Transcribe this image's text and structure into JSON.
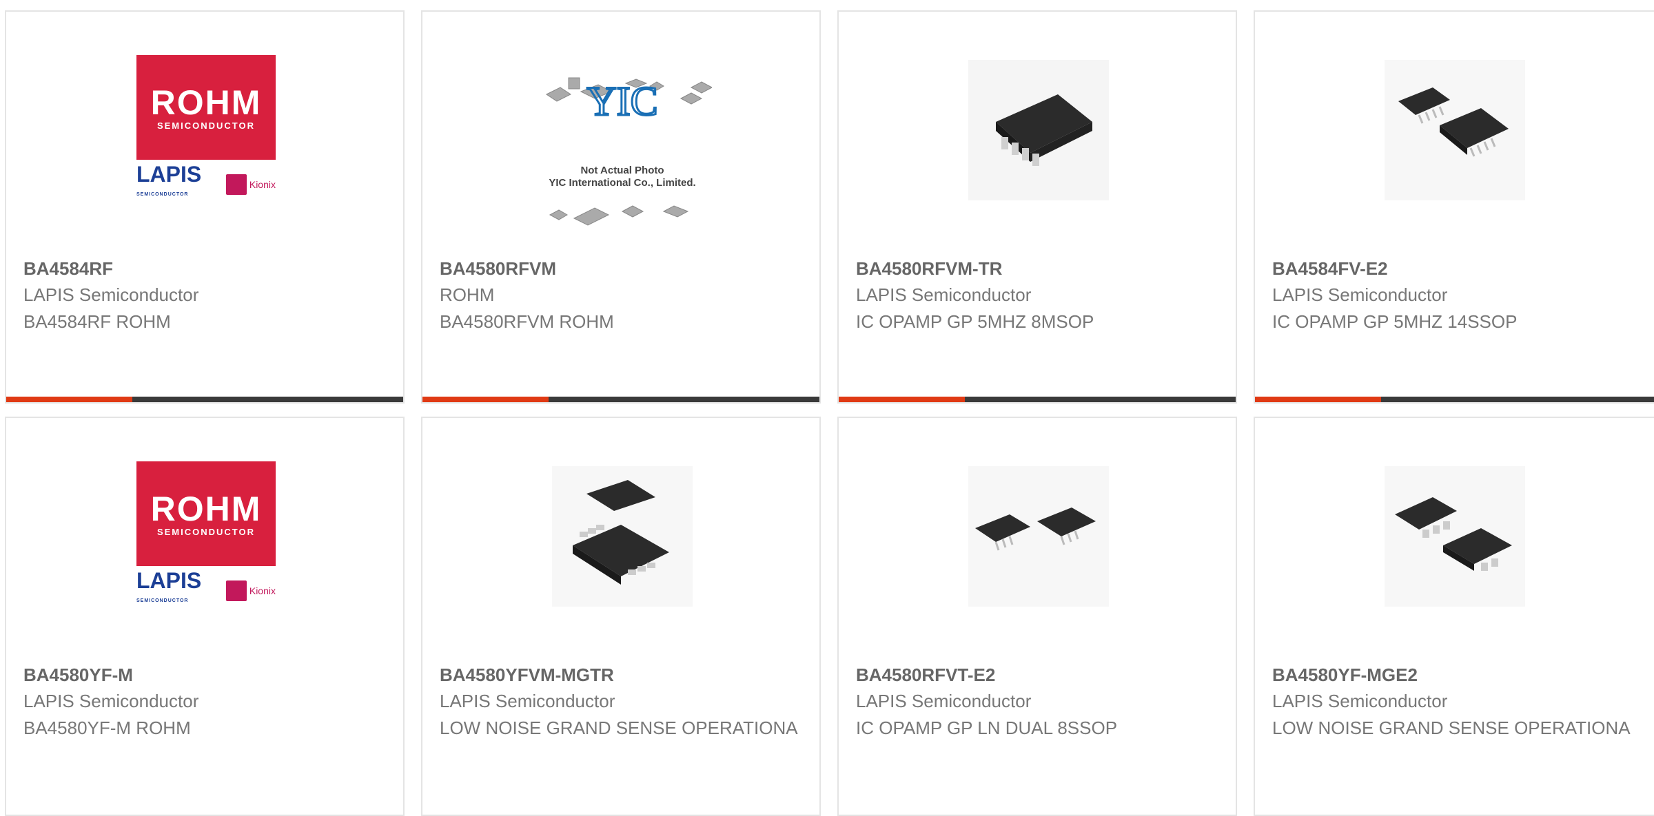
{
  "cards": [
    {
      "part": "BA4584RF",
      "manufacturer": "LAPIS Semiconductor",
      "description": "BA4584RF ROHM",
      "image": "rohm-lapis-logo"
    },
    {
      "part": "BA4580RFVM",
      "manufacturer": "ROHM",
      "description": "BA4580RFVM ROHM",
      "image": "not-actual-photo"
    },
    {
      "part": "BA4580RFVM-TR",
      "manufacturer": "LAPIS Semiconductor",
      "description": "IC OPAMP GP 5MHZ 8MSOP",
      "image": "chip-8msop"
    },
    {
      "part": "BA4584FV-E2",
      "manufacturer": "LAPIS Semiconductor",
      "description": "IC OPAMP GP 5MHZ 14SSOP",
      "image": "chip-14ssop-pair"
    },
    {
      "part": "BA4580YF-M",
      "manufacturer": "LAPIS Semiconductor",
      "description": "BA4580YF-M ROHM",
      "image": "rohm-lapis-logo"
    },
    {
      "part": "BA4580YFVM-MGTR",
      "manufacturer": "LAPIS Semiconductor",
      "description": "LOW NOISE GRAND SENSE OPERATIONA",
      "image": "chip-msop-pair"
    },
    {
      "part": "BA4580RFVT-E2",
      "manufacturer": "LAPIS Semiconductor",
      "description": "IC OPAMP GP LN DUAL 8SSOP",
      "image": "chip-ssop-pair"
    },
    {
      "part": "BA4580YF-MGE2",
      "manufacturer": "LAPIS Semiconductor",
      "description": "LOW NOISE GRAND SENSE OPERATIONA",
      "image": "chip-sop-pair"
    }
  ],
  "logos": {
    "rohm_main": "ROHM",
    "rohm_sub": "SEMICONDUCTOR",
    "lapis": "LAPIS",
    "lapis_sub": "SEMICONDUCTOR",
    "kionix": "Kionix"
  },
  "placeholder": {
    "line1": "Not Actual Photo",
    "line2": "YIC International Co., Limited."
  },
  "colors": {
    "accent": "#e03a14",
    "bar": "#3a3a3a",
    "rohm_red": "#d8203e",
    "lapis_blue": "#1c3f96",
    "text_bold": "#666666",
    "text": "#777777"
  }
}
